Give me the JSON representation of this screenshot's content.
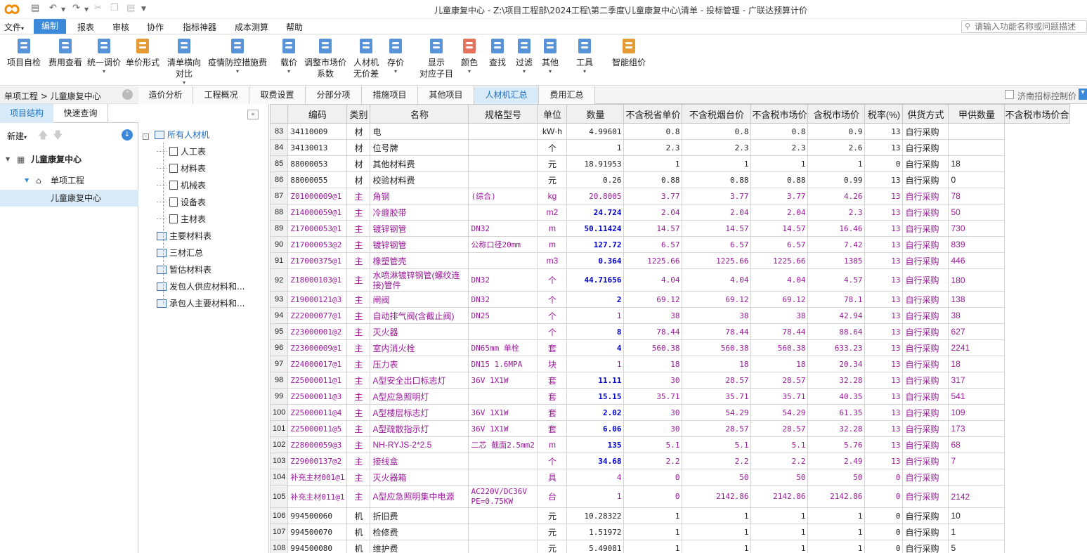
{
  "window": {
    "title": "儿童康复中心 - Z:\\项目工程部\\2024工程\\第二季度\\儿童康复中心\\清单 - 投标管理 - 广联达预算计价"
  },
  "menus": [
    "文件",
    "编制",
    "报表",
    "审核",
    "协作",
    "指标神器",
    "成本测算",
    "帮助"
  ],
  "search": {
    "placeholder": "请输入功能名称或问题描述"
  },
  "ribbon": [
    {
      "l1": "项目自检",
      "l2": "",
      "arrow": false
    },
    {
      "l1": "费用查看",
      "l2": "",
      "arrow": false
    },
    {
      "l1": "统一调价",
      "l2": "",
      "arrow": true
    },
    {
      "l1": "单价形式",
      "l2": "",
      "arrow": false
    },
    {
      "l1": "清单横向",
      "l2": "对比",
      "arrow": true
    },
    {
      "l1": "疫情防控措施费",
      "l2": "",
      "arrow": true
    },
    {
      "l1": "载价",
      "l2": "",
      "arrow": true
    },
    {
      "l1": "调整市场价",
      "l2": "系数",
      "arrow": false
    },
    {
      "l1": "人材机",
      "l2": "无价差",
      "arrow": false
    },
    {
      "l1": "存价",
      "l2": "",
      "arrow": true
    },
    {
      "l1": "显示",
      "l2": "对应子目",
      "arrow": false
    },
    {
      "l1": "颜色",
      "l2": "",
      "arrow": true
    },
    {
      "l1": "查找",
      "l2": "",
      "arrow": false
    },
    {
      "l1": "过滤",
      "l2": "",
      "arrow": true
    },
    {
      "l1": "其他",
      "l2": "",
      "arrow": true
    },
    {
      "l1": "工具",
      "l2": "",
      "arrow": true
    },
    {
      "l1": "智能组价",
      "l2": "",
      "arrow": false
    }
  ],
  "tabs": [
    "造价分析",
    "工程概况",
    "取费设置",
    "分部分项",
    "措施项目",
    "其他项目",
    "人材机汇总",
    "费用汇总"
  ],
  "jinan_control": "济南招标控制价",
  "left": {
    "breadcrumb": "单项工程 > 儿童康复中心",
    "tab1": "项目结构",
    "tab2": "快速查询",
    "new_label": "新建",
    "tree": [
      "儿童康复中心",
      "单项工程",
      "儿童康复中心"
    ]
  },
  "mid": {
    "root": "所有人材机",
    "children": [
      "人工表",
      "材料表",
      "机械表",
      "设备表",
      "主材表"
    ],
    "others": [
      "主要材料表",
      "三材汇总",
      "暂估材料表",
      "发包人供应材料和...",
      "承包人主要材料和..."
    ]
  },
  "columns": [
    "编码",
    "类别",
    "名称",
    "规格型号",
    "单位",
    "数量",
    "不含税省单价",
    "不含税烟台价",
    "不含税市场价",
    "含税市场价",
    "税率(%)",
    "供货方式",
    "甲供数量",
    "不含税市场价合"
  ],
  "rows": [
    [
      "83",
      "34110009",
      "材",
      "电",
      "",
      "kW·h",
      "4.99601",
      "0.8",
      "0.8",
      "0.8",
      "0.9",
      "13",
      "自行采购",
      ""
    ],
    [
      "84",
      "34130013",
      "材",
      "位号牌",
      "",
      "个",
      "1",
      "2.3",
      "2.3",
      "2.3",
      "2.6",
      "13",
      "自行采购",
      ""
    ],
    [
      "85",
      "88000053",
      "材",
      "其他材料费",
      "",
      "元",
      "18.91953",
      "1",
      "1",
      "1",
      "1",
      "0",
      "自行采购",
      "18"
    ],
    [
      "86",
      "88000055",
      "材",
      "校验材料费",
      "",
      "元",
      "0.26",
      "0.88",
      "0.88",
      "0.88",
      "0.99",
      "13",
      "自行采购",
      "0"
    ],
    [
      "87",
      "Z01000009@1",
      "主",
      "角钢",
      "(综合)",
      "kg",
      "20.8005",
      "3.77",
      "3.77",
      "3.77",
      "4.26",
      "13",
      "自行采购",
      "78"
    ],
    [
      "88",
      "Z14000059@1",
      "主",
      "冷缠胶带",
      "",
      "m2",
      "24.724",
      "2.04",
      "2.04",
      "2.04",
      "2.3",
      "13",
      "自行采购",
      "50"
    ],
    [
      "89",
      "Z17000053@1",
      "主",
      "镀锌钢管",
      "DN32",
      "m",
      "50.11424",
      "14.57",
      "14.57",
      "14.57",
      "16.46",
      "13",
      "自行采购",
      "730"
    ],
    [
      "90",
      "Z17000053@2",
      "主",
      "镀锌钢管",
      "公称口径20mm",
      "m",
      "127.72",
      "6.57",
      "6.57",
      "6.57",
      "7.42",
      "13",
      "自行采购",
      "839"
    ],
    [
      "91",
      "Z17000375@1",
      "主",
      "橡塑管壳",
      "",
      "m3",
      "0.364",
      "1225.66",
      "1225.66",
      "1225.66",
      "1385",
      "13",
      "自行采购",
      "446"
    ],
    [
      "92",
      "Z18000103@1",
      "主",
      "水喷淋镀锌钢管(螺纹连接)管件",
      "DN32",
      "个",
      "44.71656",
      "4.04",
      "4.04",
      "4.04",
      "4.57",
      "13",
      "自行采购",
      "180"
    ],
    [
      "93",
      "Z19000121@3",
      "主",
      "闸阀",
      "DN32",
      "个",
      "2",
      "69.12",
      "69.12",
      "69.12",
      "78.1",
      "13",
      "自行采购",
      "138"
    ],
    [
      "94",
      "Z22000077@1",
      "主",
      "自动排气阀(含截止阀)",
      "DN25",
      "个",
      "1",
      "38",
      "38",
      "38",
      "42.94",
      "13",
      "自行采购",
      "38"
    ],
    [
      "95",
      "Z23000001@2",
      "主",
      "灭火器",
      "",
      "个",
      "8",
      "78.44",
      "78.44",
      "78.44",
      "88.64",
      "13",
      "自行采购",
      "627"
    ],
    [
      "96",
      "Z23000009@1",
      "主",
      "室内消火栓",
      "DN65mm 单栓",
      "套",
      "4",
      "560.38",
      "560.38",
      "560.38",
      "633.23",
      "13",
      "自行采购",
      "2241"
    ],
    [
      "97",
      "Z24000017@1",
      "主",
      "压力表",
      "DN15 1.6MPA",
      "块",
      "1",
      "18",
      "18",
      "18",
      "20.34",
      "13",
      "自行采购",
      "18"
    ],
    [
      "98",
      "Z25000011@1",
      "主",
      "A型安全出口标志灯",
      "36V 1X1W",
      "套",
      "11.11",
      "30",
      "28.57",
      "28.57",
      "32.28",
      "13",
      "自行采购",
      "317"
    ],
    [
      "99",
      "Z25000011@3",
      "主",
      "A型应急照明灯",
      "",
      "套",
      "15.15",
      "35.71",
      "35.71",
      "35.71",
      "40.35",
      "13",
      "自行采购",
      "541"
    ],
    [
      "100",
      "Z25000011@4",
      "主",
      "A型楼层标志灯",
      "36V 1X1W",
      "套",
      "2.02",
      "30",
      "54.29",
      "54.29",
      "61.35",
      "13",
      "自行采购",
      "109"
    ],
    [
      "101",
      "Z25000011@5",
      "主",
      "A型疏散指示灯",
      "36V 1X1W",
      "套",
      "6.06",
      "30",
      "28.57",
      "28.57",
      "32.28",
      "13",
      "自行采购",
      "173"
    ],
    [
      "102",
      "Z28000059@3",
      "主",
      "NH-RYJS-2*2.5",
      "二芯 截面2.5mm2",
      "m",
      "135",
      "5.1",
      "5.1",
      "5.1",
      "5.76",
      "13",
      "自行采购",
      "68"
    ],
    [
      "103",
      "Z29000137@2",
      "主",
      "接线盒",
      "",
      "个",
      "34.68",
      "2.2",
      "2.2",
      "2.2",
      "2.49",
      "13",
      "自行采购",
      "7"
    ],
    [
      "104",
      "补充主材001@1",
      "主",
      "灭火器箱",
      "",
      "具",
      "4",
      "0",
      "50",
      "50",
      "50",
      "0",
      "自行采购",
      ""
    ],
    [
      "105",
      "补充主材011@1",
      "主",
      "A型应急照明集中电源",
      "AC220V/DC36V PE=0.75KW",
      "台",
      "1",
      "0",
      "2142.86",
      "2142.86",
      "2142.86",
      "0",
      "自行采购",
      "2142"
    ],
    [
      "106",
      "994500060",
      "机",
      "折旧费",
      "",
      "元",
      "10.28322",
      "1",
      "1",
      "1",
      "1",
      "0",
      "自行采购",
      "10"
    ],
    [
      "107",
      "994500070",
      "机",
      "检修费",
      "",
      "元",
      "1.51972",
      "1",
      "1",
      "1",
      "1",
      "0",
      "自行采购",
      "1"
    ],
    [
      "108",
      "994500080",
      "机",
      "维护费",
      "",
      "元",
      "5.49081",
      "1",
      "1",
      "1",
      "1",
      "0",
      "自行采购",
      "5"
    ]
  ]
}
